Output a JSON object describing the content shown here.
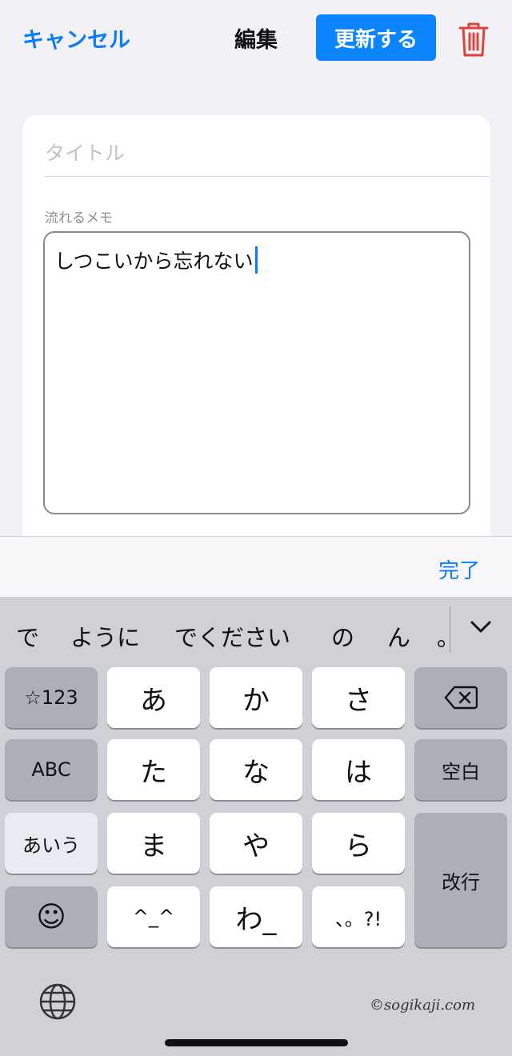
{
  "header": {
    "cancel_label": "キャンセル",
    "title": "編集",
    "update_label": "更新する"
  },
  "form": {
    "title_placeholder": "タイトル",
    "memo_label": "流れるメモ",
    "memo_text": "しつこいから忘れない"
  },
  "accessory": {
    "done_label": "完了"
  },
  "keyboard": {
    "candidates": [
      "で",
      "ように",
      "でください",
      "の",
      "ん",
      "。"
    ],
    "keys": {
      "num": "☆123",
      "a": "あ",
      "ka": "か",
      "sa": "さ",
      "abc": "ABC",
      "ta": "た",
      "na": "な",
      "ha": "は",
      "space": "空白",
      "aiu": "あいう",
      "ma": "ま",
      "ya": "や",
      "ra": "ら",
      "enter": "改行",
      "emoji": "☺",
      "kaomoji": "^_^",
      "wa": "わ_",
      "punct": "、。?!"
    }
  },
  "watermark": "©sogikaji.com",
  "colors": {
    "accent": "#0a84ff",
    "trash": "#e0433a"
  }
}
